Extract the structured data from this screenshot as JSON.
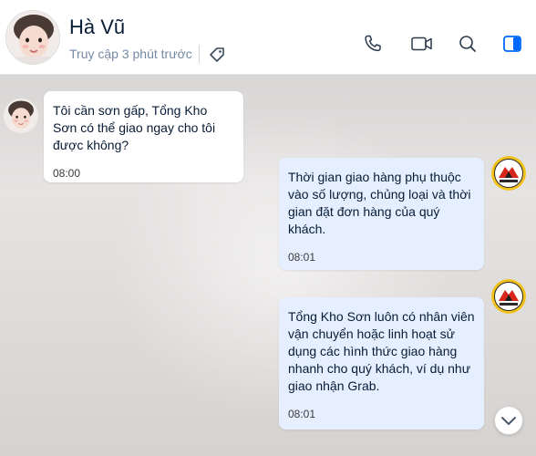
{
  "header": {
    "contact_name": "Hà Vũ",
    "status": "Truy cập 3 phút trước"
  },
  "messages": [
    {
      "direction": "in",
      "text": "Tôi cần sơn gấp, Tổng Kho Sơn có thể giao ngay cho tôi được không?",
      "time": "08:00"
    },
    {
      "direction": "out",
      "text": "Thời gian giao hàng phụ thuộc vào số lượng, chủng loại và thời gian đặt đơn hàng của quý khách.",
      "time": "08:01"
    },
    {
      "direction": "out",
      "text": "Tổng Kho Sơn luôn có nhân viên vận chuyển hoặc linh hoạt sử dụng các hình thức giao hàng nhanh cho quý khách, ví dụ như giao nhận Grab.",
      "time": "08:01"
    }
  ],
  "icons": {
    "tag": "tag-icon",
    "call": "phone-icon",
    "video": "video-camera-icon",
    "search": "search-icon",
    "panel": "sidebar-toggle-icon",
    "scroll": "chevron-down-icon"
  },
  "colors": {
    "accent": "#0068ff",
    "outgoing_bubble": "#e5efff",
    "incoming_bubble": "#ffffff"
  }
}
